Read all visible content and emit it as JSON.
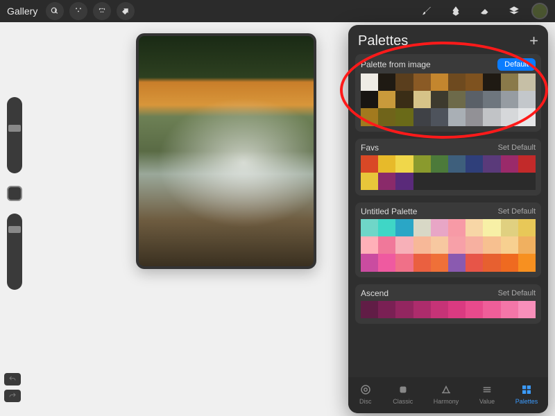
{
  "topbar": {
    "gallery_label": "Gallery"
  },
  "panel": {
    "title": "Palettes",
    "default_label": "Default",
    "set_default_label": "Set Default"
  },
  "nav": {
    "disc": "Disc",
    "classic": "Classic",
    "harmony": "Harmony",
    "value": "Value",
    "palettes": "Palettes"
  },
  "palettes": [
    {
      "name": "Palette from image",
      "is_default": true,
      "rows": [
        [
          "#efece5",
          "#1f1a13",
          "#5a3e1d",
          "#8a5a25",
          "#c4862e",
          "#6e4a1f",
          "#7e521f",
          "#1f1a13",
          "#8a7a4a",
          "#c6bfa6"
        ],
        [
          "#181512",
          "#c99a3b",
          "#3a2d16",
          "#d6c388",
          "#3d3a2e",
          "#6d6a4a",
          "#5a6068",
          "#6e767e",
          "#969ca2",
          "#c3c7cb"
        ],
        [
          "#a27a1e",
          "#70641a",
          "#6a6a18",
          "#3f4146",
          "#4e535c",
          "#a9afb5",
          "#929196",
          "#c1c3c6",
          "#d6d8da",
          "#e6e7e9"
        ]
      ]
    },
    {
      "name": "Favs",
      "is_default": false,
      "rows": [
        [
          "#d94826",
          "#e7ba2a",
          "#f0d74a",
          "#8a9a2d",
          "#4c7a3a",
          "#3e5f7c",
          "#2f3f7a",
          "#5a3a7a",
          "#9a2a6a",
          "#c22a2a"
        ],
        [
          "#e8c63a",
          "#8a2a6a",
          "#5a2a7a",
          "#",
          "#",
          "#",
          "#",
          "#",
          "#",
          "#"
        ]
      ]
    },
    {
      "name": "Untitled Palette",
      "is_default": false,
      "rows": [
        [
          "#6fd6c8",
          "#3fd6c6",
          "#2aa6c6",
          "#d8d8c6",
          "#e8a6c6",
          "#f79aa6",
          "#f7d6a6",
          "#f7f0a6",
          "#e0d080",
          "#e8c858"
        ],
        [
          "#ffb0b8",
          "#f0789a",
          "#f7b0b8",
          "#f7b898",
          "#f7c8a0",
          "#f7a0a8",
          "#f7b0a0",
          "#f7c090",
          "#f7d090",
          "#f0b060"
        ],
        [
          "#ca4ca0",
          "#ef5aa0",
          "#f07088",
          "#ea6040",
          "#ef7038",
          "#8a5ab0",
          "#e75548",
          "#e76030",
          "#ef6a20",
          "#f79020"
        ]
      ]
    },
    {
      "name": "Ascend",
      "is_default": false,
      "rows": [
        [
          "#611d46",
          "#7a2054",
          "#932660",
          "#ad2c6c",
          "#c63377",
          "#da3a81",
          "#e84a8c",
          "#ef5e99",
          "#f476a8",
          "#f88fba"
        ]
      ]
    }
  ],
  "annotation": {
    "target": "palette-from-image"
  },
  "current_color": "#4a5530"
}
